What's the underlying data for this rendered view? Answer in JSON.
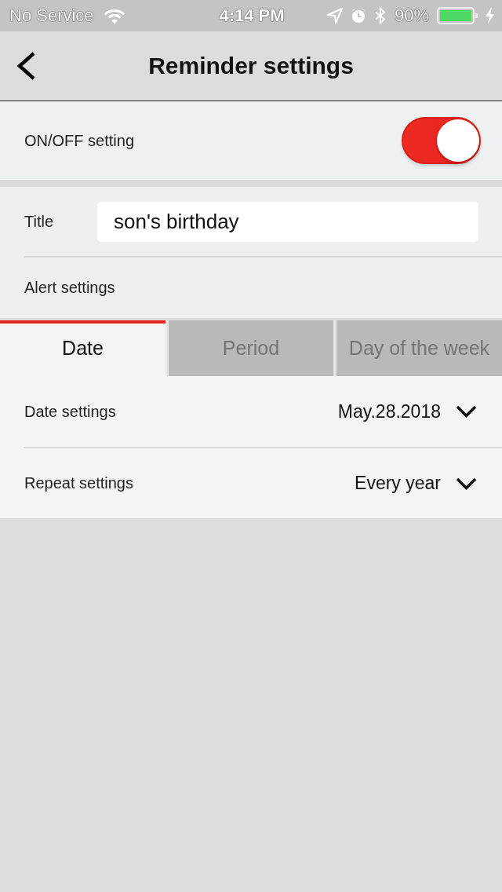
{
  "status_bar": {
    "carrier": "No Service",
    "time": "4:14 PM",
    "battery_percent": "90%"
  },
  "nav_bar": {
    "title": "Reminder settings"
  },
  "on_off": {
    "label": "ON/OFF setting",
    "on": true
  },
  "title_field": {
    "label": "Title",
    "value": "son's birthday"
  },
  "alert_settings": {
    "label": "Alert settings",
    "tabs": [
      {
        "label": "Date",
        "selected": true
      },
      {
        "label": "Period",
        "selected": false
      },
      {
        "label": "Day of the week",
        "selected": false
      }
    ],
    "rows": [
      {
        "label": "Date settings",
        "value": "May.28.2018"
      },
      {
        "label": "Repeat settings",
        "value": "Every year"
      }
    ]
  }
}
